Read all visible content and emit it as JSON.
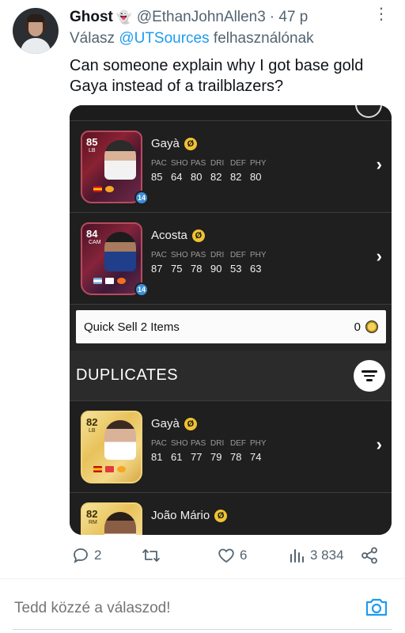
{
  "tweet": {
    "author_name": "Ghost",
    "author_emoji": "👻",
    "handle": "@EthanJohnAllen3",
    "time": "· 47 p",
    "replying_prefix": "Válasz",
    "replying_mention": "@UTSources",
    "replying_suffix": "felhasználónak",
    "text": "Can someone explain why I got base gold Gaya instead of a trailblazers?"
  },
  "media": {
    "players": [
      {
        "name": "Gayà",
        "rating": "85",
        "position": "LB",
        "badge": "14",
        "stats": {
          "labels": [
            "PAC",
            "SHO",
            "PAS",
            "DRI",
            "DEF",
            "PHY"
          ],
          "values": [
            "85",
            "64",
            "80",
            "82",
            "82",
            "80"
          ]
        }
      },
      {
        "name": "Acosta",
        "rating": "84",
        "position": "CAM",
        "badge": "14",
        "stats": {
          "labels": [
            "PAC",
            "SHO",
            "PAS",
            "DRI",
            "DEF",
            "PHY"
          ],
          "values": [
            "87",
            "75",
            "78",
            "90",
            "53",
            "63"
          ]
        }
      }
    ],
    "quick_sell": {
      "label": "Quick Sell 2 Items",
      "value": "0"
    },
    "duplicates_title": "DUPLICATES",
    "duplicates": [
      {
        "name": "Gayà",
        "rating": "82",
        "position": "LB",
        "stats": {
          "labels": [
            "PAC",
            "SHO",
            "PAS",
            "DRI",
            "DEF",
            "PHY"
          ],
          "values": [
            "81",
            "61",
            "77",
            "79",
            "78",
            "74"
          ]
        }
      },
      {
        "name": "João Mário",
        "rating": "82",
        "position": "RM"
      }
    ]
  },
  "actions": {
    "replies": "2",
    "retweets": "",
    "likes": "6",
    "views": "3 834"
  },
  "reply": {
    "placeholder": "Tedd közzé a válaszod!"
  }
}
